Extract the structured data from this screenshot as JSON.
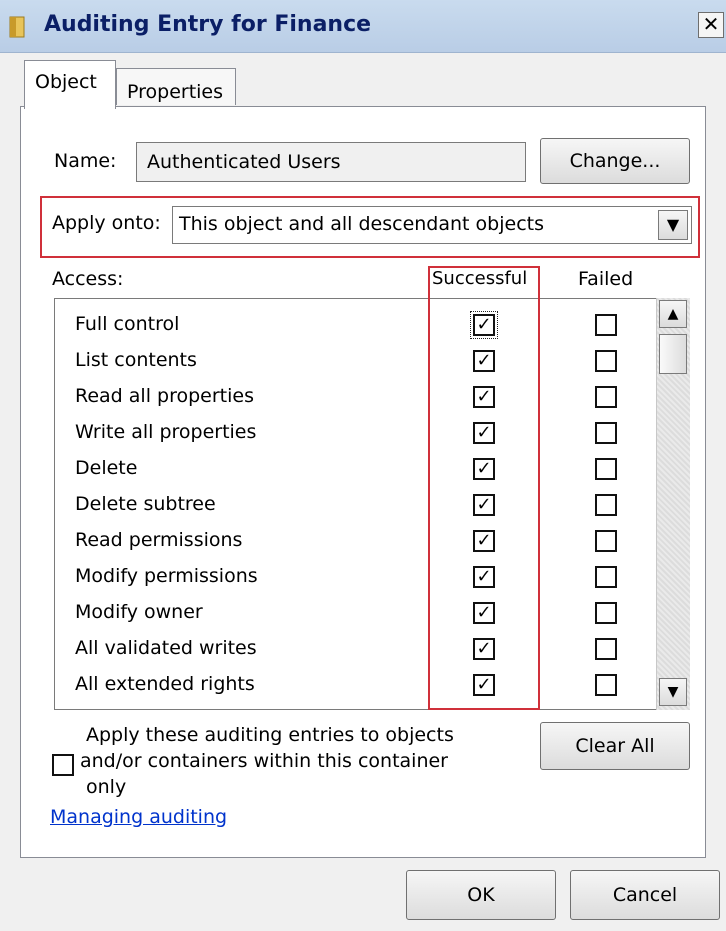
{
  "window": {
    "title": "Auditing Entry for Finance",
    "close_glyph": "✕"
  },
  "tabs": [
    {
      "label": "Object",
      "active": true
    },
    {
      "label": "Properties",
      "active": false
    }
  ],
  "name_row": {
    "label": "Name:",
    "value": "Authenticated Users",
    "change_button": "Change..."
  },
  "apply_onto": {
    "label": "Apply onto:",
    "selected": "This object and all descendant objects"
  },
  "access": {
    "label": "Access:",
    "col_successful": "Successful",
    "col_failed": "Failed",
    "items": [
      {
        "label": "Full control",
        "successful": true,
        "failed": false
      },
      {
        "label": "List contents",
        "successful": true,
        "failed": false
      },
      {
        "label": "Read all properties",
        "successful": true,
        "failed": false
      },
      {
        "label": "Write all properties",
        "successful": true,
        "failed": false
      },
      {
        "label": "Delete",
        "successful": true,
        "failed": false
      },
      {
        "label": "Delete subtree",
        "successful": true,
        "failed": false
      },
      {
        "label": "Read permissions",
        "successful": true,
        "failed": false
      },
      {
        "label": "Modify permissions",
        "successful": true,
        "failed": false
      },
      {
        "label": "Modify owner",
        "successful": true,
        "failed": false
      },
      {
        "label": "All validated writes",
        "successful": true,
        "failed": false
      },
      {
        "label": "All extended rights",
        "successful": true,
        "failed": false
      }
    ]
  },
  "apply_container": {
    "text_line1": "Apply these auditing entries to objects",
    "text_line2": "and/or containers within this container",
    "text_line3": "only",
    "checked": false
  },
  "clear_all_button": "Clear All",
  "managing_link": "Managing auditing",
  "ok_button": "OK",
  "cancel_button": "Cancel",
  "colors": {
    "highlight_red": "#d0303a",
    "link_blue": "#0033cc",
    "titlebar": "#c9dbee"
  }
}
